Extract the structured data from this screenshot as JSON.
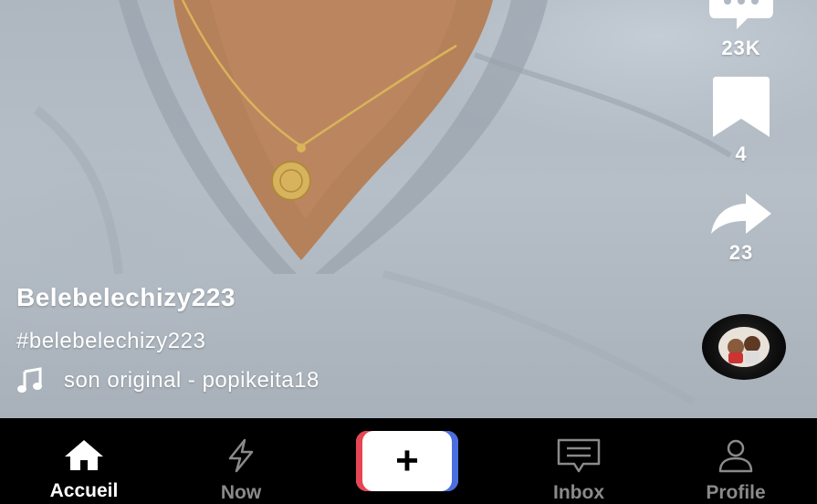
{
  "video": {
    "icons": [
      "comment-icon",
      "bookmark-icon",
      "share-icon",
      "music-note-icon",
      "music-disc"
    ]
  },
  "actions": {
    "comments_count": "23K",
    "bookmarks_count": "4",
    "shares_count": "23"
  },
  "caption": {
    "username": "Belebelechizy223",
    "hashtag": "#belebelechizy223",
    "sound": "son original - popikeita18"
  },
  "nav": {
    "home_label": "Accueil",
    "now_label": "Now",
    "create_symbol": "+",
    "inbox_label": "Inbox",
    "profile_label": "Profile"
  },
  "colors": {
    "shirt": "#b0b9c2",
    "skin": "#b5815a",
    "nav_background": "#000000",
    "nav_active": "#ffffff",
    "nav_inactive": "#8a8a8a",
    "create_left_accent": "#4a6ee0",
    "create_right_accent": "#e64553"
  }
}
